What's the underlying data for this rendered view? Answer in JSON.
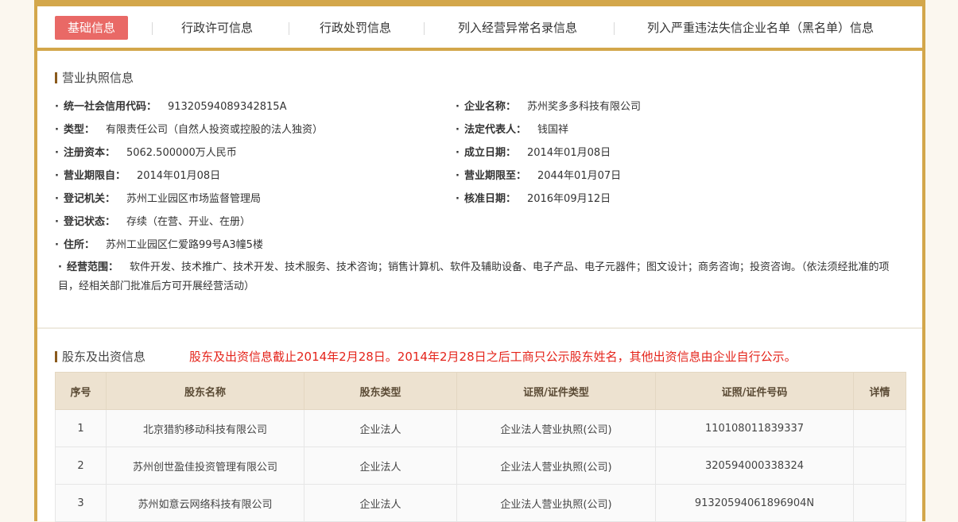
{
  "tabs": [
    {
      "label": "基础信息",
      "active": true
    },
    {
      "label": "行政许可信息"
    },
    {
      "label": "行政处罚信息"
    },
    {
      "label": "列入经营异常名录信息"
    },
    {
      "label": "列入严重违法失信企业名单（黑名单）信息"
    }
  ],
  "license": {
    "title": "营业执照信息",
    "credit_code": {
      "label": "统一社会信用代码：",
      "value": "91320594089342815A"
    },
    "company_name": {
      "label": "企业名称：",
      "value": "苏州奖多多科技有限公司"
    },
    "type": {
      "label": "类型：",
      "value": "有限责任公司（自然人投资或控股的法人独资）"
    },
    "legal_rep": {
      "label": "法定代表人：",
      "value": "钱国祥"
    },
    "capital": {
      "label": "注册资本：",
      "value": "5062.500000万人民币"
    },
    "established": {
      "label": "成立日期：",
      "value": "2014年01月08日"
    },
    "term_from": {
      "label": "营业期限自：",
      "value": "2014年01月08日"
    },
    "term_to": {
      "label": "营业期限至：",
      "value": "2044年01月07日"
    },
    "authority": {
      "label": "登记机关：",
      "value": "苏州工业园区市场监督管理局"
    },
    "approval_date": {
      "label": "核准日期：",
      "value": "2016年09月12日"
    },
    "status": {
      "label": "登记状态：",
      "value": "存续（在营、开业、在册）"
    },
    "address": {
      "label": "住所：",
      "value": "苏州工业园区仁爱路99号A3幢5楼"
    },
    "scope": {
      "label": "经营范围：",
      "value": "软件开发、技术推广、技术开发、技术服务、技术咨询；销售计算机、软件及辅助设备、电子产品、电子元器件；图文设计；商务咨询；投资咨询。（依法须经批准的项目，经相关部门批准后方可开展经营活动）"
    }
  },
  "shareholders": {
    "title": "股东及出资信息",
    "notice": "股东及出资信息截止2014年2月28日。2014年2月28日之后工商只公示股东姓名，其他出资信息由企业自行公示。",
    "headers": [
      "序号",
      "股东名称",
      "股东类型",
      "证照/证件类型",
      "证照/证件号码",
      "详情"
    ],
    "rows": [
      [
        "1",
        "北京猎豹移动科技有限公司",
        "企业法人",
        "企业法人营业执照(公司)",
        "110108011839337",
        ""
      ],
      [
        "2",
        "苏州创世盈佳投资管理有限公司",
        "企业法人",
        "企业法人营业执照(公司)",
        "320594000338324",
        ""
      ],
      [
        "3",
        "苏州如意云网络科技有限公司",
        "企业法人",
        "企业法人营业执照(公司)",
        "91320594061896904N",
        ""
      ]
    ]
  },
  "colors": {
    "accent": "#d3a74b",
    "active_tab": "#e96966",
    "notice": "#e4231a",
    "header_bg": "#ede2d0"
  }
}
